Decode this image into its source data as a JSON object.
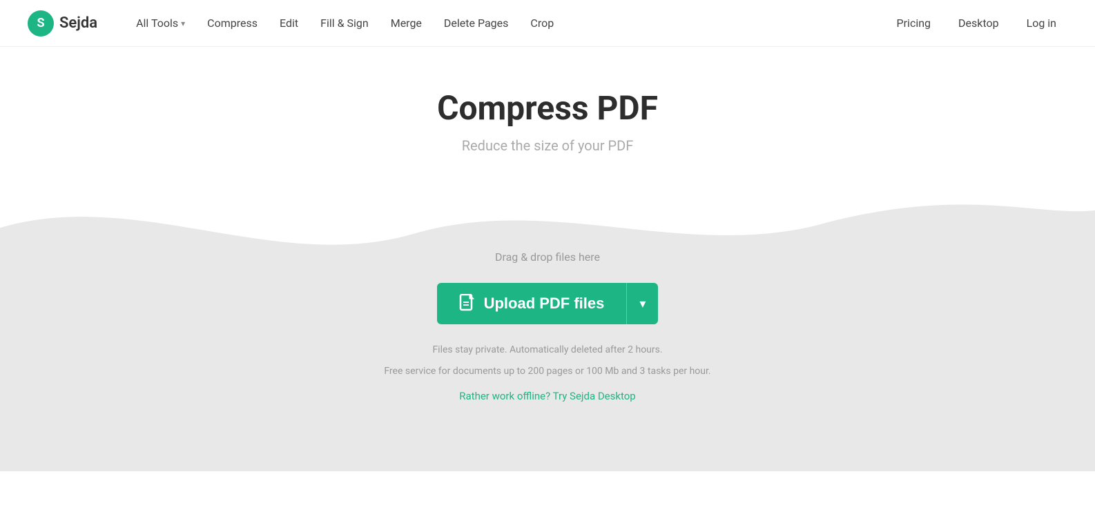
{
  "header": {
    "logo_letter": "S",
    "logo_name": "Sejda",
    "nav_items": [
      {
        "label": "All Tools",
        "has_dropdown": true
      },
      {
        "label": "Compress"
      },
      {
        "label": "Edit"
      },
      {
        "label": "Fill & Sign"
      },
      {
        "label": "Merge"
      },
      {
        "label": "Delete Pages"
      },
      {
        "label": "Crop"
      }
    ],
    "nav_right": [
      {
        "label": "Pricing"
      },
      {
        "label": "Desktop"
      },
      {
        "label": "Log in"
      }
    ]
  },
  "hero": {
    "title": "Compress PDF",
    "subtitle": "Reduce the size of your PDF"
  },
  "upload": {
    "drag_drop_text": "Drag & drop files here",
    "button_label": "Upload PDF files",
    "dropdown_arrow": "▾",
    "privacy_line1": "Files stay private. Automatically deleted after 2 hours.",
    "privacy_line2": "Free service for documents up to 200 pages or 100 Mb and 3 tasks per hour.",
    "offline_link": "Rather work offline? Try Sejda Desktop"
  },
  "colors": {
    "brand_green": "#1db584",
    "wave_bg": "#ebebeb"
  }
}
